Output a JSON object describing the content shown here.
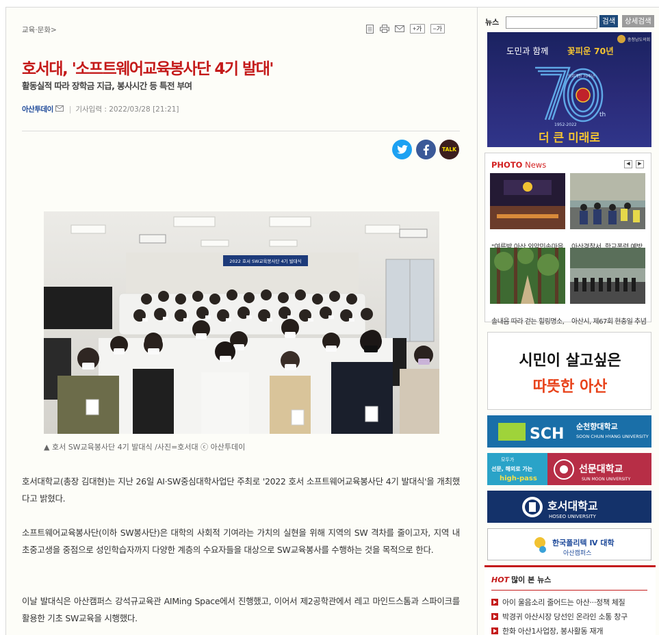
{
  "breadcrumb": {
    "section": "교육·문화",
    "arrow": ">"
  },
  "tools": {
    "font_plus": "+가",
    "font_minus": "−가"
  },
  "article": {
    "headline": "호서대, '소프트웨어교육봉사단 4기 발대'",
    "subhead": "활동실적 따라 장학금 지급, 봉사시간 등 특전 부여",
    "author": "아산투데이",
    "date_sep": "|",
    "date": "기사입력 : 2022/03/28 [21:21]",
    "share_kakao": "TALK",
    "photo": {
      "banner_text": "2022 호서 SW교육봉사단 4기 발대식",
      "caption": "▲ 호서 SW교육봉사단 4기 발대식 /사진=호서대    ⓒ 아산투데이"
    },
    "paragraphs": [
      " 호서대학교(총장 김대현)는 지난 26일 AI·SW중심대학사업단 주최로 '2022 호서 소프트웨어교육봉사단 4기 발대식'을 개최했다고 밝혔다.",
      "소프트웨어교육봉사단(이하 SW봉사단)은 대학의 사회적 기여라는 가치의 실현을 위해 지역의 SW 격차를 줄이고자, 지역 내 초중고생을 중점으로 성인학습자까지 다양한 계층의 수요자들을 대상으로 SW교육봉사를 수행하는 것을 목적으로 한다.",
      "이날 발대식은 아산캠퍼스 강석규교육관 AIMing Space에서 진행했고, 이어서 제2공학관에서 레고 마인드스톰과 스파이크를 활용한 기초 SW교육을 시행했다."
    ]
  },
  "sidebar": {
    "news_label": "뉴스",
    "search_button": "검색",
    "detail_search_button": "상세검색",
    "banner70": {
      "top_text": "도민과 함께",
      "highlight": "꽃피운 70년",
      "badge": "충청남도의회",
      "small_label": "의회개원 70주년",
      "years": "1952-2022",
      "big_number": "70",
      "th": "th",
      "bottom_text": "더 큰 미래로"
    },
    "photo_news": {
      "title_a": "PHOTO",
      "title_b": " News",
      "prev": "◀",
      "next": "▶",
      "items": [
        {
          "caption": "\"여름밤 아산 외암민속마을"
        },
        {
          "caption": "아산경찰서, 학교폭력 예방"
        },
        {
          "caption": "솔내음 따라 걷는 힐링명소,"
        },
        {
          "caption": "아산시, 제67회 현충일 추념"
        }
      ]
    },
    "ads": {
      "asan_line1": "시민이 살고싶은",
      "asan_line2": "따뜻한 아산",
      "sch_logo": "SCH",
      "sch_kr": "순천향대학교",
      "sch_en": "SOON CHUN HYANG UNIVERSITY",
      "sunmoon_small1": "모두가",
      "sunmoon_small2": "선문, 해외로 가는",
      "sunmoon_small3": "high-pass",
      "sunmoon_kr": "선문대학교",
      "sunmoon_en": "SUN MOON UNIVERSITY",
      "hoseo_kr": "호서대학교",
      "hoseo_en": "HOSEO UNIVERSITY",
      "poly_line1": "한국폴리텍 Ⅳ 대학",
      "poly_line2": "아산캠퍼스"
    },
    "hot_news": {
      "hot": "HOT",
      "title": "많이 본 뉴스",
      "items": [
        "아이 울음소리 줄어드는 아산···정책 체질",
        "박경귀 아산시장 당선인 온라인 소통 창구",
        "한화 아산1사업장, 봉사활동 재개"
      ]
    }
  }
}
